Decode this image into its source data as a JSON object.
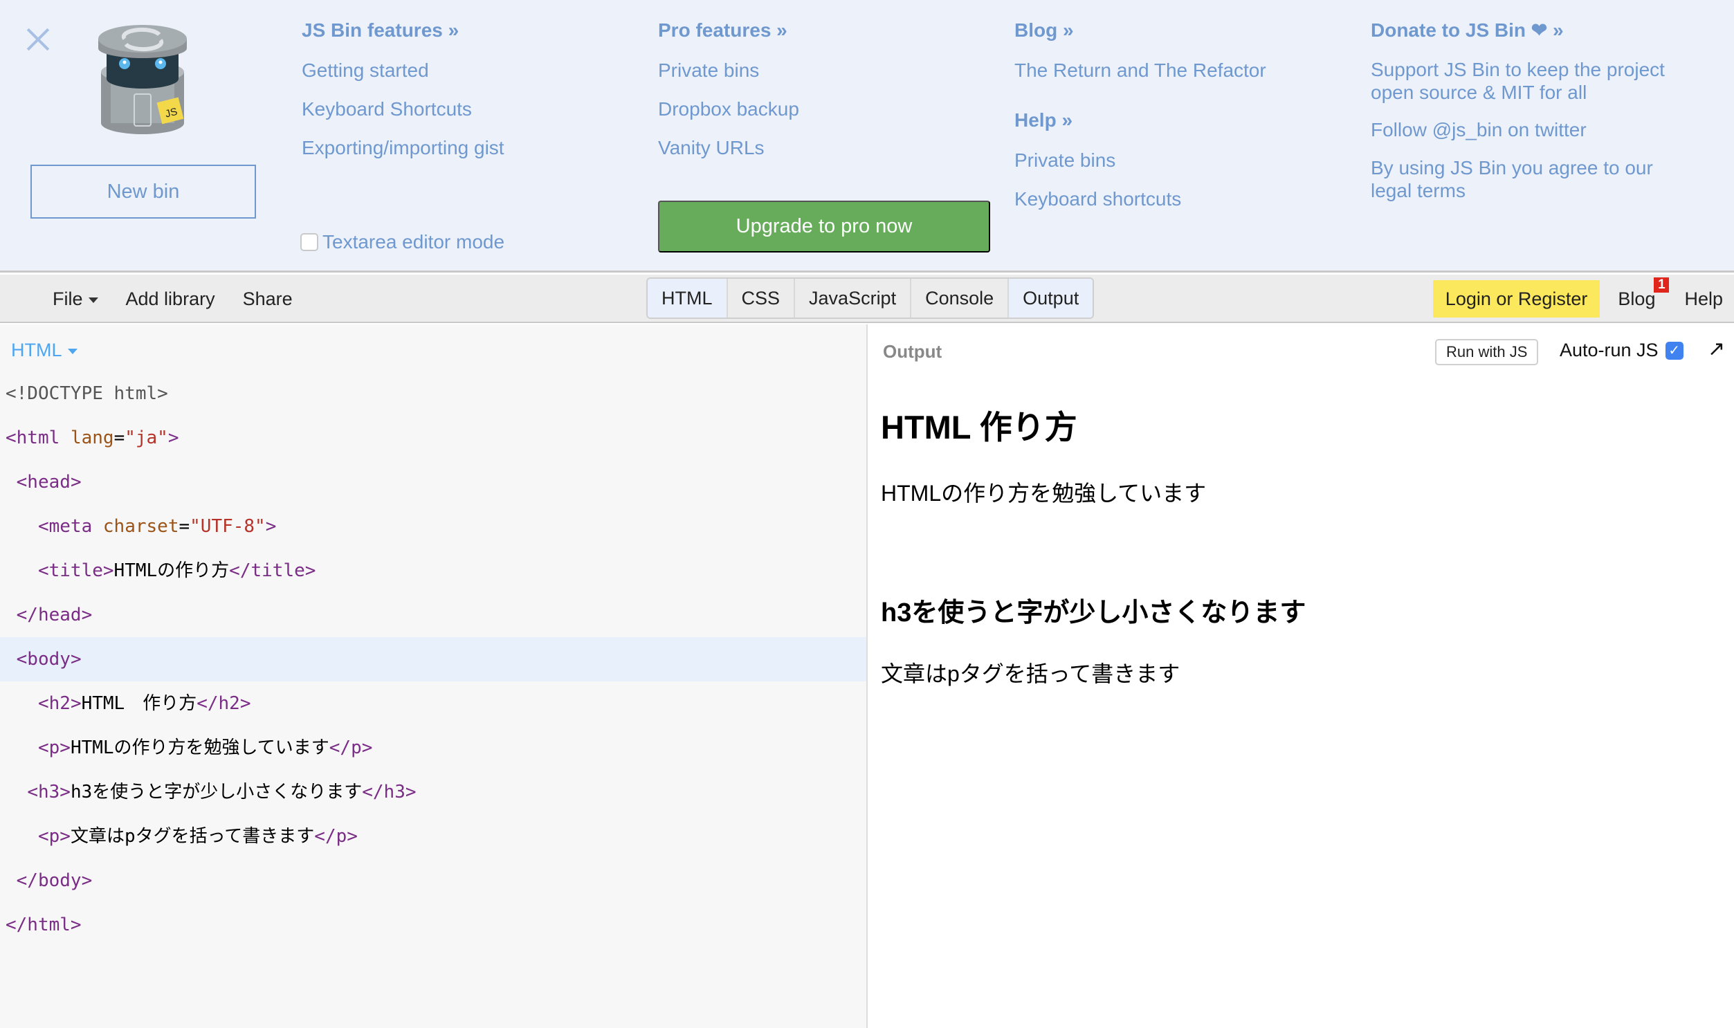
{
  "panel": {
    "new_bin": "New bin",
    "columns": [
      {
        "heading": "JS Bin features »",
        "links": [
          "Getting started",
          "Keyboard Shortcuts",
          "Exporting/importing gist"
        ]
      },
      {
        "heading": "Pro features »",
        "links": [
          "Private bins",
          "Dropbox backup",
          "Vanity URLs"
        ]
      },
      {
        "heading": "Blog »",
        "links": [
          "The Return and The Refactor"
        ],
        "heading2": "Help »",
        "links2": [
          "Private bins",
          "Keyboard shortcuts"
        ]
      },
      {
        "heading": "Donate to JS Bin ❤ »",
        "links": [
          "Support JS Bin to keep the project open source & MIT for all",
          "Follow @js_bin on twitter",
          "By using JS Bin you agree to our legal terms"
        ]
      }
    ],
    "textarea_mode": "Textarea editor mode",
    "textarea_mode_checked": false,
    "upgrade": "Upgrade to pro now"
  },
  "toolbar": {
    "file": "File",
    "add_library": "Add library",
    "share": "Share",
    "tabs": [
      {
        "label": "HTML",
        "active": true
      },
      {
        "label": "CSS",
        "active": false
      },
      {
        "label": "JavaScript",
        "active": false
      },
      {
        "label": "Console",
        "active": false
      },
      {
        "label": "Output",
        "active": true
      }
    ],
    "login": "Login or Register",
    "blog": "Blog",
    "blog_badge": "1",
    "help": "Help"
  },
  "editor": {
    "language": "HTML",
    "lines": [
      "<!DOCTYPE html>",
      "<html lang=\"ja\">",
      " <head>",
      "   <meta charset=\"UTF-8\">",
      "   <title>HTMLの作り方</title>",
      " </head>",
      " <body>",
      "   <h2>HTML　作り方</h2>",
      "   <p>HTMLの作り方を勉強しています</p>",
      "  <h3>h3を使うと字が少し小さくなります</h3>",
      "   <p>文章はpタグを括って書きます</p>",
      " </body>",
      "</html>"
    ],
    "active_line": 7
  },
  "output": {
    "label": "Output",
    "run_with_js": "Run with JS",
    "auto_run": "Auto-run JS",
    "auto_run_checked": true,
    "h2": "HTML 作り方",
    "p1": "HTMLの作り方を勉強しています",
    "h3": "h3を使うと字が少し小さくなります",
    "p2": "文章はpタグを括って書きます"
  }
}
